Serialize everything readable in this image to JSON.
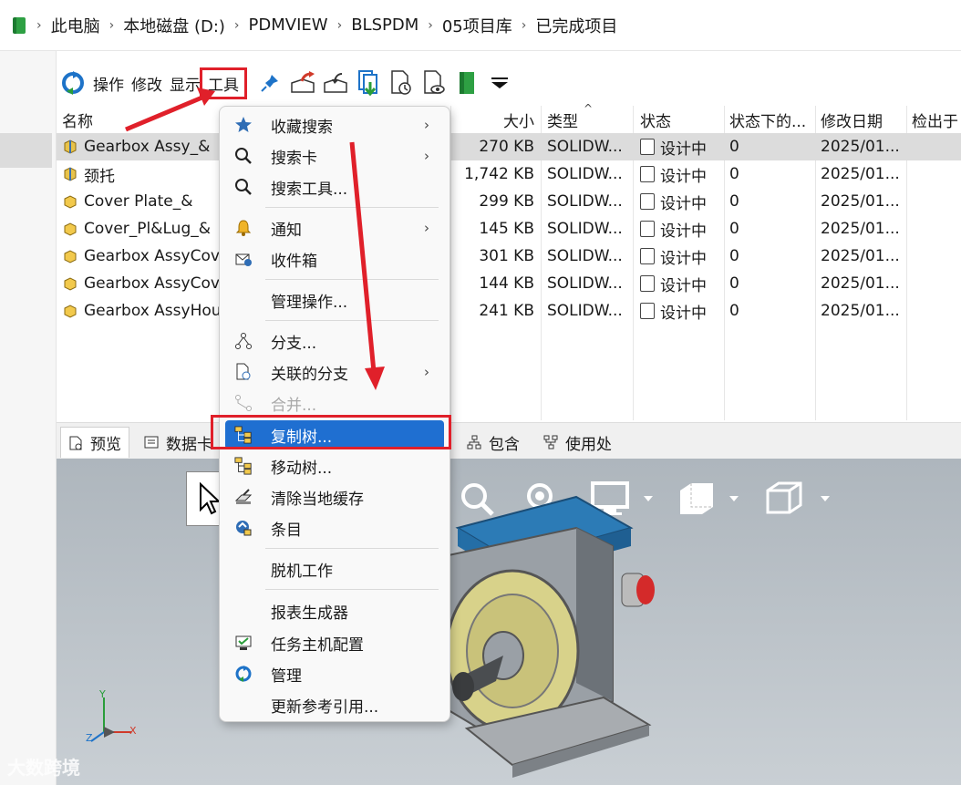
{
  "breadcrumb": [
    "此电脑",
    "本地磁盘 (D:)",
    "PDMVIEW",
    "BLSPDM",
    "05项目库",
    "已完成项目"
  ],
  "toolbar": {
    "menus": [
      "操作",
      "修改",
      "显示",
      "工具"
    ],
    "icons": [
      "refresh-icon",
      "pin-icon",
      "check-out-icon",
      "check-in-icon",
      "get-latest-icon",
      "history-icon",
      "preview-doc-icon",
      "green-book-icon",
      "dropdown-triangle-icon"
    ]
  },
  "file_list": {
    "columns": [
      "名称",
      "大小",
      "类型",
      "状态",
      "状态下的...",
      "修改日期",
      "检出于"
    ],
    "rows": [
      {
        "name": "Gearbox Assy_&",
        "size": "270 KB",
        "type": "SOLIDW...",
        "state": "设计中",
        "count": "0",
        "date": "2025/01...",
        "icon": "assembly"
      },
      {
        "name": "颈托",
        "size": "1,742 KB",
        "type": "SOLIDW...",
        "state": "设计中",
        "count": "0",
        "date": "2025/01...",
        "icon": "assembly"
      },
      {
        "name": "Cover Plate_&",
        "size": "299 KB",
        "type": "SOLIDW...",
        "state": "设计中",
        "count": "0",
        "date": "2025/01...",
        "icon": "part"
      },
      {
        "name": "Cover_Pl&Lug_&",
        "size": "145 KB",
        "type": "SOLIDW...",
        "state": "设计中",
        "count": "0",
        "date": "2025/01...",
        "icon": "part"
      },
      {
        "name": "Gearbox AssyCov",
        "size": "301 KB",
        "type": "SOLIDW...",
        "state": "设计中",
        "count": "0",
        "date": "2025/01...",
        "icon": "part"
      },
      {
        "name": "Gearbox AssyCov",
        "size": "144 KB",
        "type": "SOLIDW...",
        "state": "设计中",
        "count": "0",
        "date": "2025/01...",
        "icon": "part"
      },
      {
        "name": "Gearbox AssyHou",
        "size": "241 KB",
        "type": "SOLIDW...",
        "state": "设计中",
        "count": "0",
        "date": "2025/01...",
        "icon": "part"
      }
    ]
  },
  "tabs": [
    "预览",
    "数据卡",
    "包含",
    "使用处"
  ],
  "menu": {
    "items": [
      {
        "label": "收藏搜索",
        "icon": "star-icon",
        "submenu": true
      },
      {
        "label": "搜索卡",
        "icon": "search-icon",
        "submenu": true
      },
      {
        "label": "搜索工具...",
        "icon": "search-icon",
        "submenu": false
      },
      {
        "label": "通知",
        "icon": "bell-icon",
        "submenu": true
      },
      {
        "label": "收件箱",
        "icon": "inbox-icon",
        "submenu": false
      },
      {
        "label": "管理操作...",
        "icon": "",
        "submenu": false
      },
      {
        "label": "分支...",
        "icon": "branch-icon",
        "submenu": false
      },
      {
        "label": "关联的分支",
        "icon": "linked-branch-icon",
        "submenu": true
      },
      {
        "label": "合并...",
        "icon": "merge-icon",
        "submenu": false,
        "disabled": true
      },
      {
        "label": "复制树...",
        "icon": "copy-tree-icon",
        "submenu": false,
        "highlighted": true
      },
      {
        "label": "移动树...",
        "icon": "move-tree-icon",
        "submenu": false
      },
      {
        "label": "清除当地缓存",
        "icon": "clear-cache-icon",
        "submenu": false
      },
      {
        "label": "条目",
        "icon": "item-icon",
        "submenu": false
      },
      {
        "label": "脱机工作",
        "icon": "",
        "submenu": false
      },
      {
        "label": "报表生成器",
        "icon": "",
        "submenu": false
      },
      {
        "label": "任务主机配置",
        "icon": "task-host-icon",
        "submenu": false
      },
      {
        "label": "管理",
        "icon": "admin-icon",
        "submenu": false
      },
      {
        "label": "更新参考引用...",
        "icon": "",
        "submenu": false
      }
    ]
  },
  "axes": {
    "x": "X",
    "y": "Y",
    "z": "Z"
  },
  "watermark": "大数跨境",
  "colors": {
    "highlight": "#1f6fd1",
    "annotation": "#e0202a",
    "model_blue": "#2c7bb6",
    "model_yellow": "#d8d28a"
  }
}
